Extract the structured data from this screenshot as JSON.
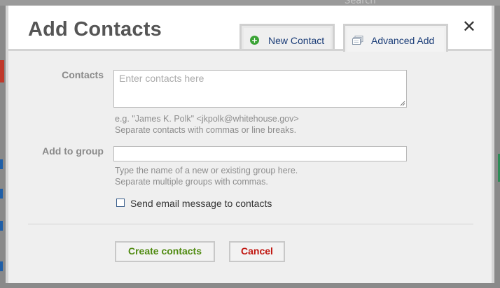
{
  "dialog": {
    "title": "Add Contacts",
    "close_glyph": "✕",
    "tabs": [
      {
        "label": "New Contact",
        "icon": "plus-circle-icon",
        "active": false
      },
      {
        "label": "Advanced Add",
        "icon": "contact-cards-icon",
        "active": true
      }
    ]
  },
  "form": {
    "contacts_label": "Contacts",
    "contacts_placeholder": "Enter contacts here",
    "contacts_hint_1": "e.g. \"James K. Polk\" <jkpolk@whitehouse.gov>",
    "contacts_hint_2": "Separate contacts with commas or line breaks.",
    "group_label": "Add to group",
    "group_value": "",
    "group_hint_1": "Type the name of a new or existing group here.",
    "group_hint_2": "Separate multiple groups with commas.",
    "send_email_label": "Send email message to contacts",
    "send_email_checked": false
  },
  "actions": {
    "create_label": "Create contacts",
    "cancel_label": "Cancel"
  },
  "background": {
    "faint_text": "Search"
  },
  "colors": {
    "create": "#4f8a10",
    "cancel": "#c0150f",
    "tab_text": "#1b3d78",
    "plus_icon": "#3aa335"
  }
}
